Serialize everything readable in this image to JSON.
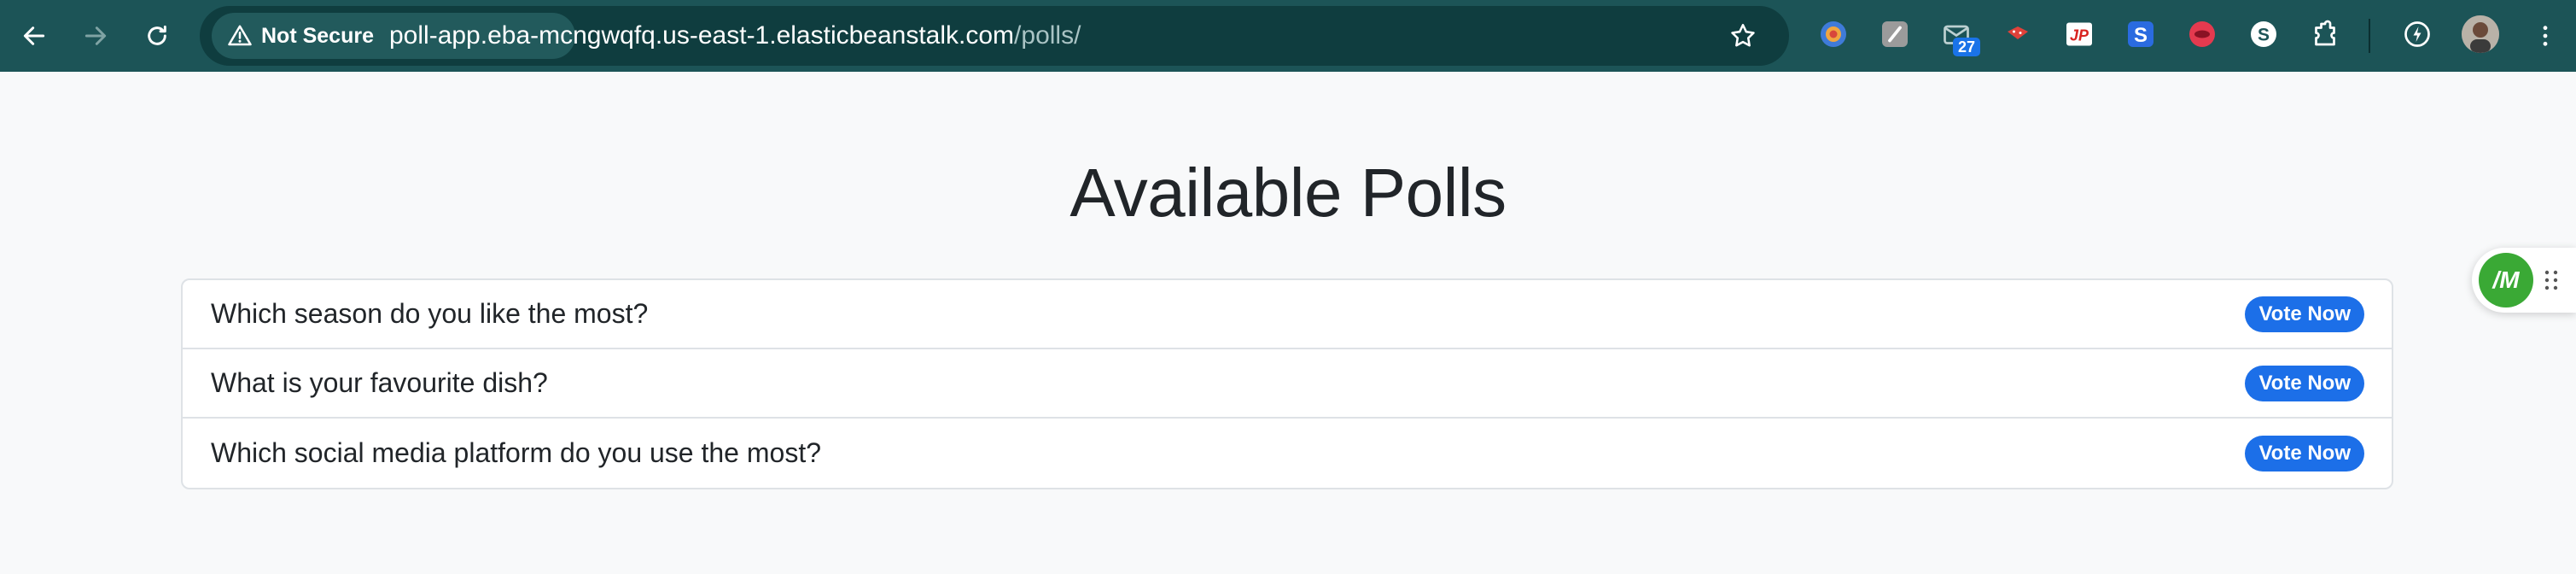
{
  "browser": {
    "security_label": "Not Secure",
    "url_host": "poll-app.eba-mcngwqfq.us-east-1.elasticbeanstalk.com",
    "url_path": "/polls/",
    "extensions": [
      {
        "name": "extension-1",
        "badge": ""
      },
      {
        "name": "extension-2",
        "badge": ""
      },
      {
        "name": "extension-mail",
        "badge": "27"
      }
    ]
  },
  "page": {
    "title": "Available Polls",
    "polls": [
      {
        "question": "Which season do you like the most?",
        "action": "Vote Now"
      },
      {
        "question": "What is your favourite dish?",
        "action": "Vote Now"
      },
      {
        "question": "Which social media platform do you use the most?",
        "action": "Vote Now"
      }
    ]
  },
  "widget": {
    "logo_text": "/M"
  },
  "colors": {
    "toolbar": "#1c5457",
    "omnibox": "#0f3d3f",
    "page_background": "#f8f9fa",
    "vote_button": "#1c6fe8",
    "widget_logo": "#3aa935"
  }
}
